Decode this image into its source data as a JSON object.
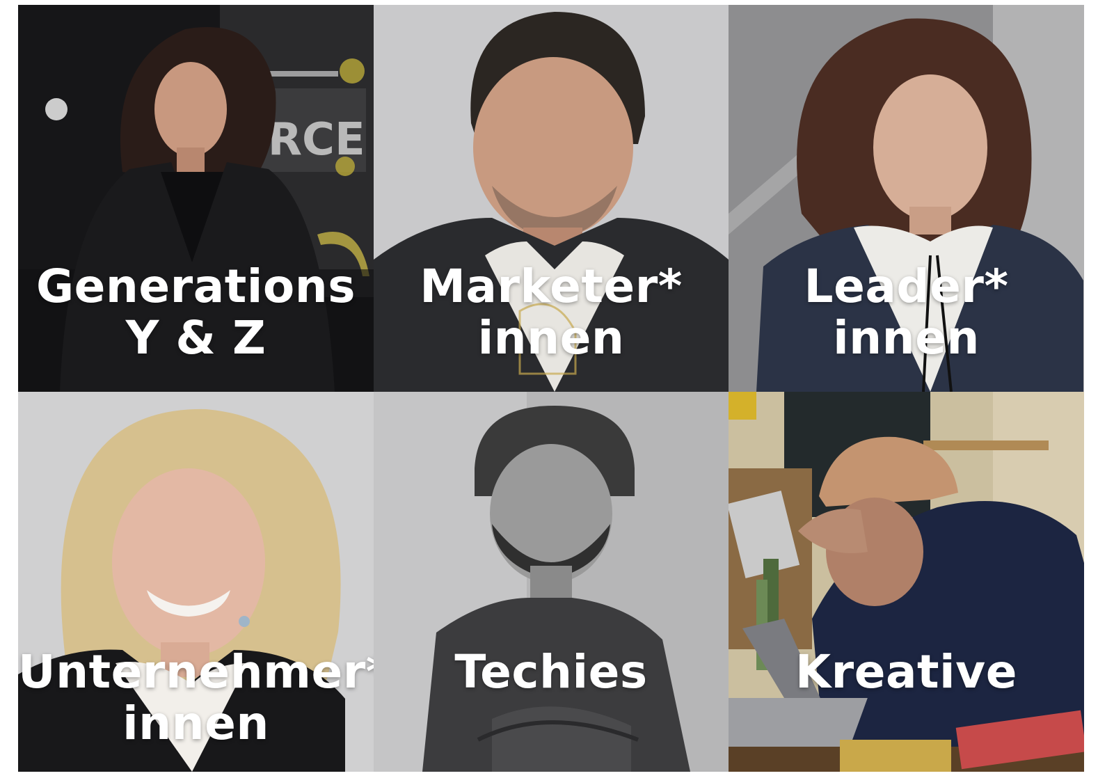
{
  "tiles": [
    {
      "id": "generations",
      "lines": [
        "Generations",
        "Y & Z"
      ],
      "photo": "woman-dark-hair-stage"
    },
    {
      "id": "marketer",
      "lines": [
        "Marketer*",
        "innen"
      ],
      "photo": "man-smiling-grey-background"
    },
    {
      "id": "leader",
      "lines": [
        "Leader*",
        "innen"
      ],
      "photo": "woman-wavy-hair-jacket"
    },
    {
      "id": "unternehmer",
      "lines": [
        "Unternehmer*",
        "innen"
      ],
      "photo": "woman-blonde-smiling"
    },
    {
      "id": "techies",
      "lines": [
        "Techies"
      ],
      "photo": "man-beanie-beard-bw"
    },
    {
      "id": "kreative",
      "lines": [
        "Kreative"
      ],
      "photo": "man-beanie-laptop-desk"
    }
  ],
  "colors": {
    "label": "#ffffff",
    "tile1_bg": "#1c1c1e",
    "tile2_bg": "#c9c9cb",
    "tile3_bg": "#8e8e8e",
    "tile4_bg": "#cfcfd0",
    "tile5_bg": "#b4b4b4",
    "tile6_bg": "#8a7a66"
  }
}
